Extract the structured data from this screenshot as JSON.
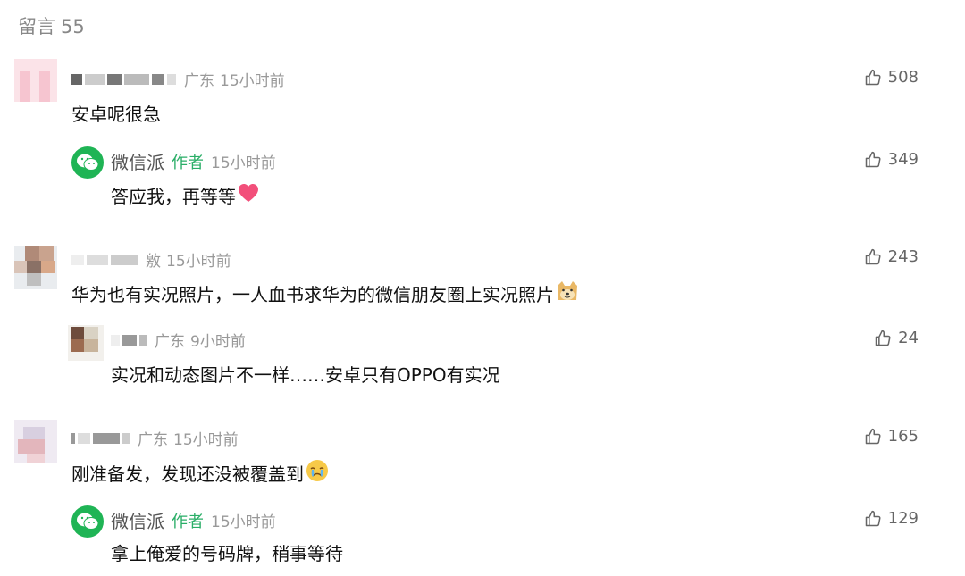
{
  "header": {
    "title": "留言",
    "count": "55"
  },
  "comments": [
    {
      "location": "广东",
      "time": "15小时前",
      "text": "安卓呢很急",
      "likes": "508"
    },
    {
      "nickname": "微信派",
      "badge": "作者",
      "time": "15小时前",
      "text": "答应我，再等等",
      "likes": "349"
    },
    {
      "nick_tail": "敫",
      "time": "15小时前",
      "text": "华为也有实况照片，一人血书求华为的微信朋友圈上实况照片",
      "likes": "243"
    },
    {
      "location": "广东",
      "time": "9小时前",
      "text": "实况和动态图片不一样……安卓只有OPPO有实况",
      "likes": "24"
    },
    {
      "location": "广东",
      "time": "15小时前",
      "text": "刚准备发，发现还没被覆盖到",
      "likes": "165"
    },
    {
      "nickname": "微信派",
      "badge": "作者",
      "time": "15小时前",
      "text": "拿上俺爱的号码牌，稍事等待",
      "likes": "129"
    }
  ],
  "icons": {
    "like": "thumbs-up-icon",
    "wechat": "wechat-logo-icon",
    "heart": "heart-emoji",
    "doge": "doge-emoji",
    "cry": "crying-emoji"
  },
  "colors": {
    "author_badge": "#2aae67",
    "wechat_green": "#1fb455",
    "meta_gray": "#999999"
  }
}
